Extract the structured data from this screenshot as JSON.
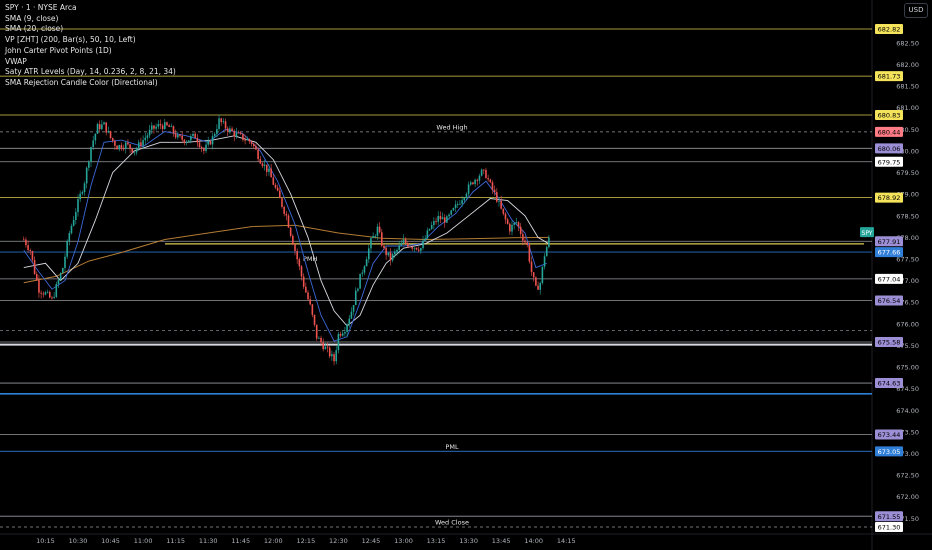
{
  "legend": {
    "symbol": "SPY · 1 · NYSE Arca",
    "indicators": [
      "SMA (9, close)",
      "SMA (20, close)",
      "VP [ZHT] (200, Bar(s), 50, 10, Left)",
      "John Carter Pivot Points (1D)",
      "VWAP",
      "Saty ATR Levels (Day, 14, 0.236, 2, 8, 21, 34)",
      "SMA Rejection Candle Color (Directional)"
    ]
  },
  "currency_button": "USD",
  "colors": {
    "background": "#000000",
    "bull": "#26a69a",
    "bear": "#ef5350",
    "atr_level": "#f5e35b",
    "pivot_level": "#d9dbe3",
    "blue_level": "#2f7ed8",
    "purple_badge": "#9c8fd6",
    "sma9": "#3b68d8",
    "sma20": "#d9dbe3",
    "vwap": "#b27c34",
    "ticker_badge": "#26a69a"
  },
  "chart_data": {
    "type": "candlestick",
    "symbol": "SPY",
    "ylim": [
      671.25,
      683.0
    ],
    "y_ticks": [
      "682.50",
      "682.00",
      "681.50",
      "681.00",
      "680.50",
      "680.00",
      "679.50",
      "679.00",
      "678.50",
      "678.00",
      "677.50",
      "677.00",
      "676.50",
      "676.00",
      "675.50",
      "675.00",
      "674.50",
      "674.00",
      "673.50",
      "673.00",
      "672.50",
      "672.00",
      "671.50"
    ],
    "x_ticks": [
      {
        "label": "10:15",
        "minute": -15
      },
      {
        "label": "10:30",
        "minute": 0
      },
      {
        "label": "10:45",
        "minute": 15
      },
      {
        "label": "11:00",
        "minute": 30
      },
      {
        "label": "11:15",
        "minute": 45
      },
      {
        "label": "11:30",
        "minute": 60
      },
      {
        "label": "11:45",
        "minute": 75
      },
      {
        "label": "12:00",
        "minute": 90
      },
      {
        "label": "12:15",
        "minute": 105
      },
      {
        "label": "12:30",
        "minute": 120
      },
      {
        "label": "12:45",
        "minute": 135
      },
      {
        "label": "13:00",
        "minute": 150
      },
      {
        "label": "13:15",
        "minute": 165
      },
      {
        "label": "13:30",
        "minute": 180
      },
      {
        "label": "13:45",
        "minute": 195
      },
      {
        "label": "14:00",
        "minute": 210
      },
      {
        "label": "14:15",
        "minute": 225
      }
    ],
    "close_path": [
      {
        "minute": -25,
        "price": 677.95
      },
      {
        "minute": -22,
        "price": 677.7
      },
      {
        "minute": -20,
        "price": 677.2
      },
      {
        "minute": -18,
        "price": 676.8
      },
      {
        "minute": -15,
        "price": 676.7
      },
      {
        "minute": -12,
        "price": 676.55
      },
      {
        "minute": -10,
        "price": 676.85
      },
      {
        "minute": -7,
        "price": 677.3
      },
      {
        "minute": -4,
        "price": 678.1
      },
      {
        "minute": 0,
        "price": 678.8
      },
      {
        "minute": 3,
        "price": 679.3
      },
      {
        "minute": 6,
        "price": 680.1
      },
      {
        "minute": 9,
        "price": 680.55
      },
      {
        "minute": 12,
        "price": 680.6
      },
      {
        "minute": 15,
        "price": 680.3
      },
      {
        "minute": 18,
        "price": 680.1
      },
      {
        "minute": 22,
        "price": 680.15
      },
      {
        "minute": 26,
        "price": 680.0
      },
      {
        "minute": 30,
        "price": 680.25
      },
      {
        "minute": 34,
        "price": 680.5
      },
      {
        "minute": 38,
        "price": 680.6
      },
      {
        "minute": 42,
        "price": 680.55
      },
      {
        "minute": 46,
        "price": 680.3
      },
      {
        "minute": 50,
        "price": 680.25
      },
      {
        "minute": 54,
        "price": 680.35
      },
      {
        "minute": 58,
        "price": 680.0
      },
      {
        "minute": 62,
        "price": 680.3
      },
      {
        "minute": 65,
        "price": 680.7
      },
      {
        "minute": 68,
        "price": 680.55
      },
      {
        "minute": 72,
        "price": 680.4
      },
      {
        "minute": 76,
        "price": 680.3
      },
      {
        "minute": 80,
        "price": 680.2
      },
      {
        "minute": 84,
        "price": 679.8
      },
      {
        "minute": 88,
        "price": 679.5
      },
      {
        "minute": 92,
        "price": 679.0
      },
      {
        "minute": 96,
        "price": 678.5
      },
      {
        "minute": 100,
        "price": 677.7
      },
      {
        "minute": 104,
        "price": 676.9
      },
      {
        "minute": 107,
        "price": 676.4
      },
      {
        "minute": 110,
        "price": 675.7
      },
      {
        "minute": 113,
        "price": 675.5
      },
      {
        "minute": 116,
        "price": 675.3
      },
      {
        "minute": 118,
        "price": 675.15
      },
      {
        "minute": 120,
        "price": 675.75
      },
      {
        "minute": 123,
        "price": 675.9
      },
      {
        "minute": 126,
        "price": 676.3
      },
      {
        "minute": 129,
        "price": 676.9
      },
      {
        "minute": 132,
        "price": 677.4
      },
      {
        "minute": 135,
        "price": 677.9
      },
      {
        "minute": 138,
        "price": 678.2
      },
      {
        "minute": 141,
        "price": 677.7
      },
      {
        "minute": 144,
        "price": 677.5
      },
      {
        "minute": 147,
        "price": 677.7
      },
      {
        "minute": 150,
        "price": 677.9
      },
      {
        "minute": 154,
        "price": 677.8
      },
      {
        "minute": 158,
        "price": 677.75
      },
      {
        "minute": 162,
        "price": 678.2
      },
      {
        "minute": 166,
        "price": 678.45
      },
      {
        "minute": 170,
        "price": 678.4
      },
      {
        "minute": 174,
        "price": 678.7
      },
      {
        "minute": 178,
        "price": 679.0
      },
      {
        "minute": 182,
        "price": 679.3
      },
      {
        "minute": 186,
        "price": 679.5
      },
      {
        "minute": 188,
        "price": 679.45
      },
      {
        "minute": 190,
        "price": 679.2
      },
      {
        "minute": 193,
        "price": 678.9
      },
      {
        "minute": 196,
        "price": 678.5
      },
      {
        "minute": 199,
        "price": 678.2
      },
      {
        "minute": 202,
        "price": 678.35
      },
      {
        "minute": 205,
        "price": 678.0
      },
      {
        "minute": 207,
        "price": 677.8
      },
      {
        "minute": 209,
        "price": 677.2
      },
      {
        "minute": 211,
        "price": 676.8
      },
      {
        "minute": 213,
        "price": 676.95
      },
      {
        "minute": 215,
        "price": 677.6
      },
      {
        "minute": 217,
        "price": 677.95
      }
    ],
    "sma9": [
      {
        "minute": -25,
        "price": 677.7
      },
      {
        "minute": -18,
        "price": 677.2
      },
      {
        "minute": -12,
        "price": 676.8
      },
      {
        "minute": -6,
        "price": 677.0
      },
      {
        "minute": 0,
        "price": 677.9
      },
      {
        "minute": 6,
        "price": 679.2
      },
      {
        "minute": 12,
        "price": 680.2
      },
      {
        "minute": 20,
        "price": 680.25
      },
      {
        "minute": 30,
        "price": 680.1
      },
      {
        "minute": 40,
        "price": 680.45
      },
      {
        "minute": 50,
        "price": 680.35
      },
      {
        "minute": 60,
        "price": 680.2
      },
      {
        "minute": 68,
        "price": 680.5
      },
      {
        "minute": 76,
        "price": 680.4
      },
      {
        "minute": 84,
        "price": 680.0
      },
      {
        "minute": 92,
        "price": 679.3
      },
      {
        "minute": 100,
        "price": 678.3
      },
      {
        "minute": 106,
        "price": 677.2
      },
      {
        "minute": 112,
        "price": 676.2
      },
      {
        "minute": 118,
        "price": 675.6
      },
      {
        "minute": 124,
        "price": 675.7
      },
      {
        "minute": 130,
        "price": 676.5
      },
      {
        "minute": 136,
        "price": 677.4
      },
      {
        "minute": 142,
        "price": 677.8
      },
      {
        "minute": 150,
        "price": 677.8
      },
      {
        "minute": 158,
        "price": 677.85
      },
      {
        "minute": 166,
        "price": 678.25
      },
      {
        "minute": 174,
        "price": 678.55
      },
      {
        "minute": 182,
        "price": 679.05
      },
      {
        "minute": 188,
        "price": 679.3
      },
      {
        "minute": 194,
        "price": 678.9
      },
      {
        "minute": 200,
        "price": 678.4
      },
      {
        "minute": 206,
        "price": 678.1
      },
      {
        "minute": 211,
        "price": 677.3
      },
      {
        "minute": 216,
        "price": 677.4
      }
    ],
    "sma20": [
      {
        "minute": -25,
        "price": 677.3
      },
      {
        "minute": -15,
        "price": 677.4
      },
      {
        "minute": -8,
        "price": 677.0
      },
      {
        "minute": 0,
        "price": 677.4
      },
      {
        "minute": 8,
        "price": 678.4
      },
      {
        "minute": 16,
        "price": 679.5
      },
      {
        "minute": 26,
        "price": 680.0
      },
      {
        "minute": 38,
        "price": 680.2
      },
      {
        "minute": 50,
        "price": 680.2
      },
      {
        "minute": 62,
        "price": 680.25
      },
      {
        "minute": 72,
        "price": 680.35
      },
      {
        "minute": 82,
        "price": 680.2
      },
      {
        "minute": 90,
        "price": 679.8
      },
      {
        "minute": 98,
        "price": 679.0
      },
      {
        "minute": 106,
        "price": 678.0
      },
      {
        "minute": 112,
        "price": 677.0
      },
      {
        "minute": 118,
        "price": 676.3
      },
      {
        "minute": 124,
        "price": 675.95
      },
      {
        "minute": 130,
        "price": 676.2
      },
      {
        "minute": 136,
        "price": 676.9
      },
      {
        "minute": 142,
        "price": 677.4
      },
      {
        "minute": 150,
        "price": 677.75
      },
      {
        "minute": 160,
        "price": 677.85
      },
      {
        "minute": 170,
        "price": 678.1
      },
      {
        "minute": 180,
        "price": 678.5
      },
      {
        "minute": 190,
        "price": 678.9
      },
      {
        "minute": 198,
        "price": 678.85
      },
      {
        "minute": 206,
        "price": 678.5
      },
      {
        "minute": 212,
        "price": 678.0
      },
      {
        "minute": 217,
        "price": 677.85
      }
    ],
    "vwap": [
      {
        "minute": -25,
        "price": 676.95
      },
      {
        "minute": -10,
        "price": 677.1
      },
      {
        "minute": 5,
        "price": 677.45
      },
      {
        "minute": 20,
        "price": 677.65
      },
      {
        "minute": 40,
        "price": 677.95
      },
      {
        "minute": 60,
        "price": 678.1
      },
      {
        "minute": 80,
        "price": 678.25
      },
      {
        "minute": 100,
        "price": 678.28
      },
      {
        "minute": 120,
        "price": 678.1
      },
      {
        "minute": 140,
        "price": 677.98
      },
      {
        "minute": 160,
        "price": 677.95
      },
      {
        "minute": 180,
        "price": 677.97
      },
      {
        "minute": 200,
        "price": 677.99
      },
      {
        "minute": 217,
        "price": 678.0
      }
    ],
    "levels": [
      {
        "price": 682.82,
        "label": "682.82",
        "type": "atr"
      },
      {
        "price": 681.73,
        "label": "681.73",
        "type": "atr"
      },
      {
        "price": 680.83,
        "label": "680.83",
        "type": "atr"
      },
      {
        "price": 680.44,
        "label": "680.44",
        "type": "wed-high",
        "text": "Wed High"
      },
      {
        "price": 680.06,
        "label": "680.06",
        "type": "pivot-purple"
      },
      {
        "price": 679.75,
        "label": "679.75",
        "type": "pivot-white"
      },
      {
        "price": 678.92,
        "label": "678.92",
        "type": "atr"
      },
      {
        "price": 677.91,
        "label": "677.91",
        "type": "pivot-purple"
      },
      {
        "price": 677.66,
        "label": "677.66",
        "type": "blue"
      },
      {
        "price": 677.04,
        "label": "677.04",
        "type": "pivot-white"
      },
      {
        "price": 676.54,
        "label": "676.54",
        "type": "pivot-purple"
      },
      {
        "price": 675.58,
        "label": "675.58",
        "type": "pivot-purple"
      },
      {
        "price": 674.63,
        "label": "674.63",
        "type": "pivot-purple"
      },
      {
        "price": 673.44,
        "label": "673.44",
        "type": "pivot-purple"
      },
      {
        "price": 673.05,
        "label": "673.05",
        "type": "blue",
        "text": "PML"
      },
      {
        "price": 671.55,
        "label": "671.55",
        "type": "pivot-purple"
      },
      {
        "price": 671.3,
        "label": "671.30",
        "type": "pivot-white",
        "text": "Wed Close"
      }
    ],
    "annotations": [
      {
        "text": "PMH",
        "minute": 107,
        "price": 677.45
      }
    ],
    "last_price_label": "SPY"
  }
}
